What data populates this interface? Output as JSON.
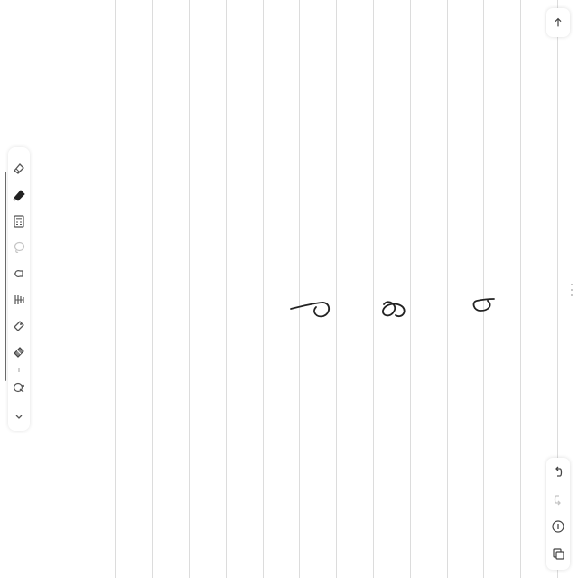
{
  "app": {
    "background": "#ffffff",
    "rule_color": "#dcdcdc",
    "ink_color": "#222222",
    "accent_icon_color": "#555555",
    "disabled_icon_color": "#c4c4c4"
  },
  "toolbar": {
    "tools": [
      {
        "icon": "eraser-icon"
      },
      {
        "icon": "pen-icon",
        "selected": true
      },
      {
        "icon": "calculator-icon"
      },
      {
        "icon": "lasso-icon",
        "disabled": true
      },
      {
        "icon": "shapes-icon"
      },
      {
        "icon": "text-tool-icon"
      },
      {
        "icon": "highlighter-icon"
      },
      {
        "icon": "marker-icon"
      },
      {
        "icon": "settings-icon"
      },
      {
        "icon": "chevron-down-icon"
      }
    ]
  },
  "right_panel": {
    "top_button": {
      "icon": "arrow-up-icon"
    },
    "bottom_buttons": [
      {
        "icon": "undo-icon"
      },
      {
        "icon": "redo-icon",
        "disabled": true
      },
      {
        "icon": "info-icon"
      },
      {
        "icon": "copy-pages-icon"
      }
    ]
  },
  "handwriting": [
    {
      "glyph": "9"
    },
    {
      "glyph": "8"
    },
    {
      "glyph": "9"
    }
  ]
}
